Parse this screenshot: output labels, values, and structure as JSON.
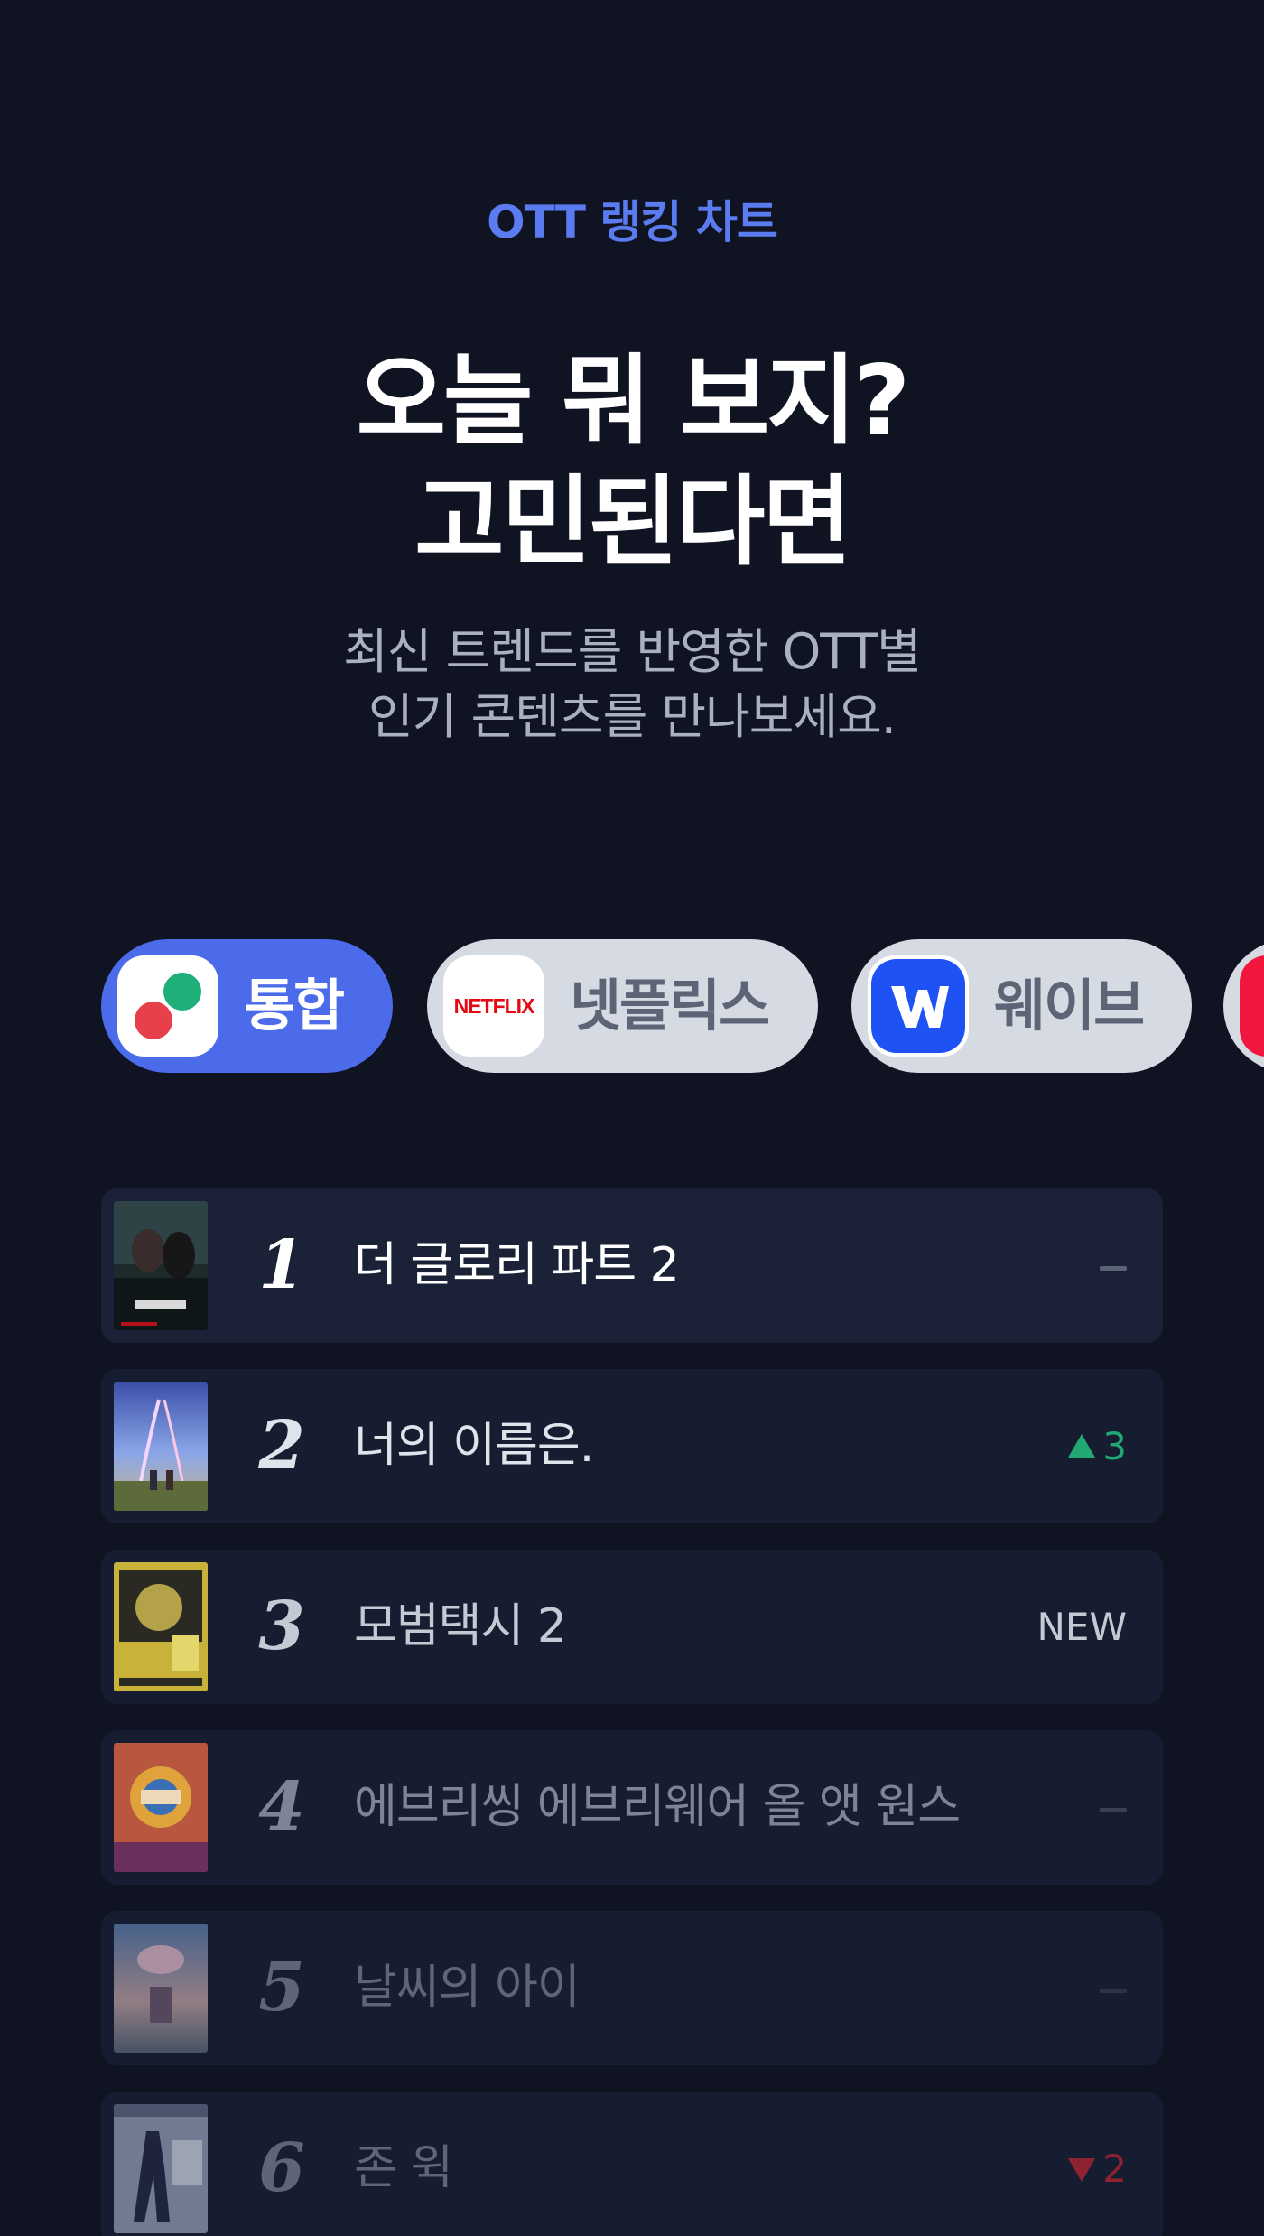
{
  "header": {
    "eyebrow": "OTT 랭킹 차트",
    "headline_line1": "오늘 뭐 보지?",
    "headline_line2": "고민된다면",
    "sub_line1": "최신 트렌드를 반영한 OTT별",
    "sub_line2": "인기 콘텐츠를 만나보세요."
  },
  "tabs": [
    {
      "label": "통합",
      "icon": "integrated-logo-icon",
      "active": true
    },
    {
      "label": "넷플릭스",
      "icon": "netflix-logo-icon",
      "logo_text": "NETFLIX",
      "active": false
    },
    {
      "label": "웨이브",
      "icon": "wavve-logo-icon",
      "active": false
    }
  ],
  "ranking": [
    {
      "rank": "1",
      "title": "더 글로리 파트 2",
      "change": "",
      "change_type": "same"
    },
    {
      "rank": "2",
      "title": "너의 이름은.",
      "change": "3",
      "change_type": "up"
    },
    {
      "rank": "3",
      "title": "모범택시 2",
      "change": "NEW",
      "change_type": "new"
    },
    {
      "rank": "4",
      "title": "에브리씽 에브리웨어 올 앳 원스",
      "change": "",
      "change_type": "same"
    },
    {
      "rank": "5",
      "title": "날씨의 아이",
      "change": "",
      "change_type": "same"
    },
    {
      "rank": "6",
      "title": "존 윅",
      "change": "2",
      "change_type": "down"
    }
  ],
  "colors": {
    "background": "#0f1322",
    "accent": "#5b7cf0",
    "active_tab": "#4b6bea",
    "up": "#21a873",
    "down": "#8e2231",
    "netflix_red": "#e50914",
    "wavve_blue": "#1f52f5"
  }
}
